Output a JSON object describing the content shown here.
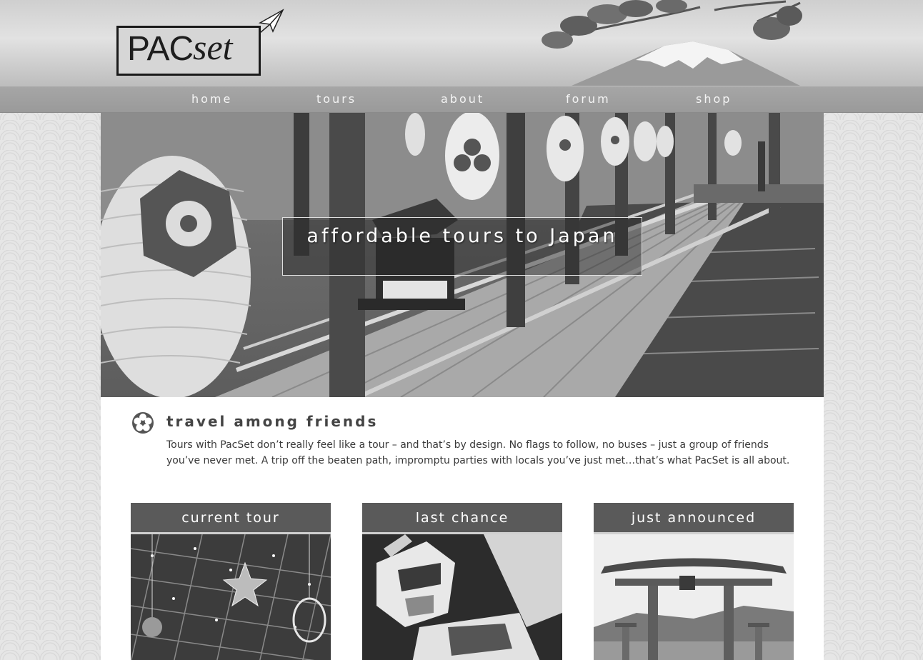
{
  "brand": {
    "logo_part1": "PAC",
    "logo_part2": "set"
  },
  "nav": {
    "items": [
      {
        "label": "home"
      },
      {
        "label": "tours"
      },
      {
        "label": "about"
      },
      {
        "label": "forum"
      },
      {
        "label": "shop"
      }
    ]
  },
  "hero": {
    "caption": "affordable tours to Japan"
  },
  "intro": {
    "heading": "travel among friends",
    "body": "Tours with PacSet don’t really feel like a tour – and that’s by design. No flags to follow, no buses – just a group of friends you’ve never met. A trip off the beaten path, impromptu parties with locals you’ve just met…that’s what PacSet is all about."
  },
  "cards": [
    {
      "title": "current tour"
    },
    {
      "title": "last chance"
    },
    {
      "title": "just announced"
    }
  ],
  "colors": {
    "nav_bar": "#9f9f9f",
    "card_header": "#5a5a5a",
    "page_background": "#e6e6e6",
    "content_background": "#ffffff"
  },
  "icons": {
    "logo_plane": "paper-plane-icon",
    "intro_flower": "flower-icon"
  }
}
